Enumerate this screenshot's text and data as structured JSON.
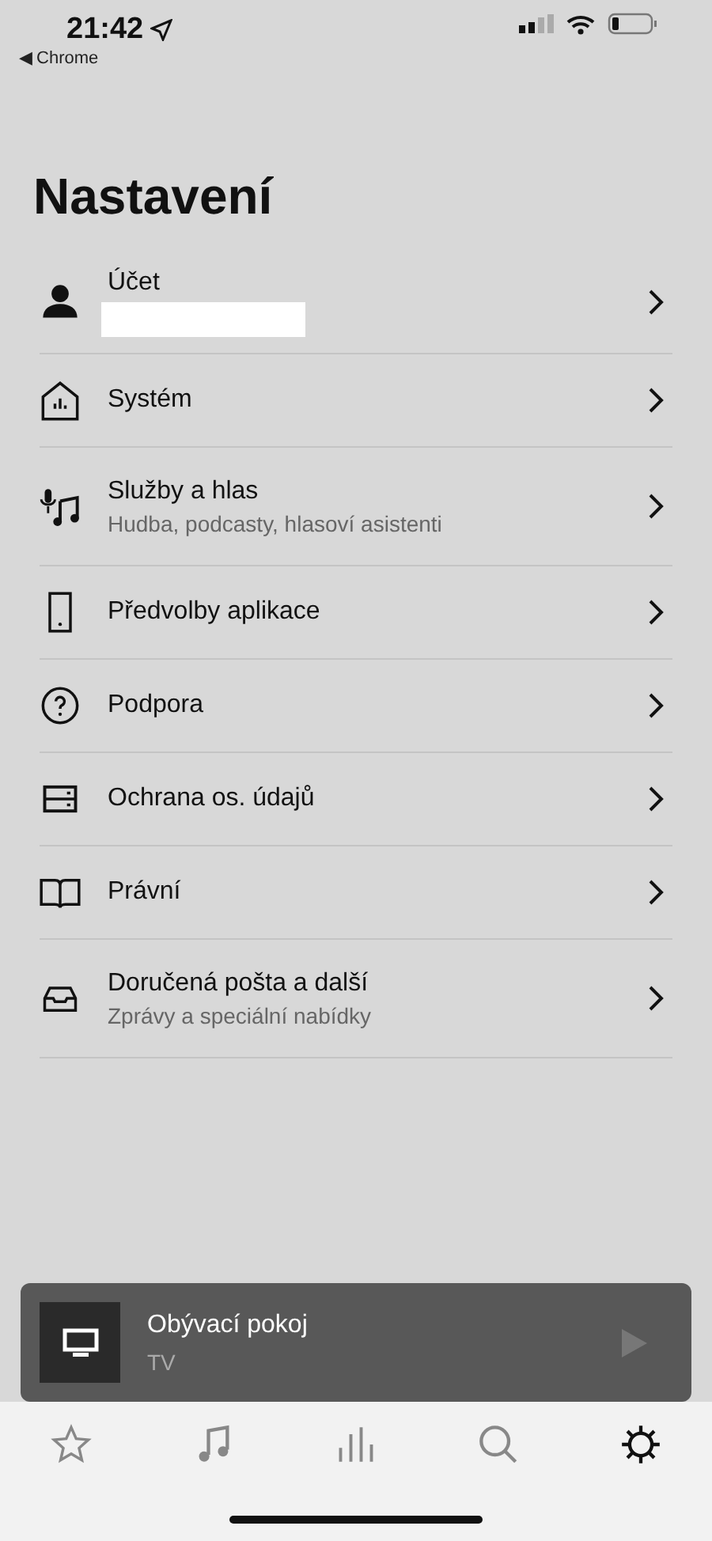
{
  "status_bar": {
    "time": "21:42",
    "back_label": "◀ Chrome"
  },
  "title": "Nastavení",
  "items": [
    {
      "label": "Účet",
      "redacted": true
    },
    {
      "label": "Systém"
    },
    {
      "label": "Služby a hlas",
      "subtitle": "Hudba, podcasty, hlasoví asistenti"
    },
    {
      "label": "Předvolby aplikace"
    },
    {
      "label": "Podpora"
    },
    {
      "label": "Ochrana os. údajů"
    },
    {
      "label": "Právní"
    },
    {
      "label": "Doručená pošta a další",
      "subtitle": "Zprávy a speciální nabídky"
    }
  ],
  "now_playing": {
    "room": "Obývací pokoj",
    "source": "TV"
  },
  "tabs": [
    {
      "selected": false
    },
    {
      "selected": false
    },
    {
      "selected": false
    },
    {
      "selected": false
    },
    {
      "selected": true
    }
  ]
}
